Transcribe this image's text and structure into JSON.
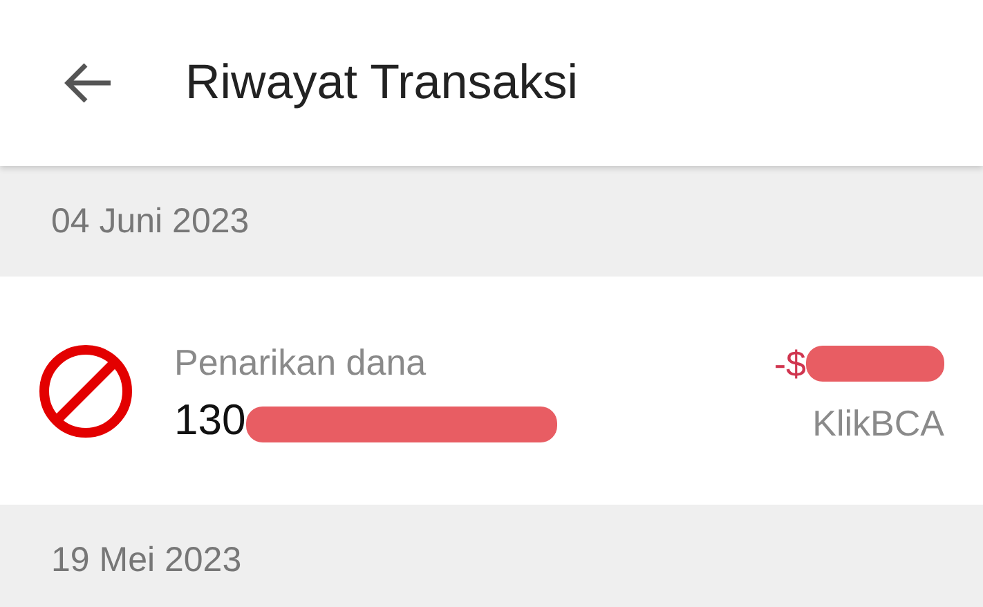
{
  "header": {
    "title": "Riwayat Transaksi"
  },
  "sections": [
    {
      "date": "04 Juni 2023",
      "transactions": [
        {
          "kind": "withdrawal",
          "title": "Penarikan dana",
          "account": "130",
          "amount": "-$",
          "method": "KlikBCA",
          "redacted": true
        }
      ]
    },
    {
      "date": "19 Mei 2023"
    }
  ]
}
